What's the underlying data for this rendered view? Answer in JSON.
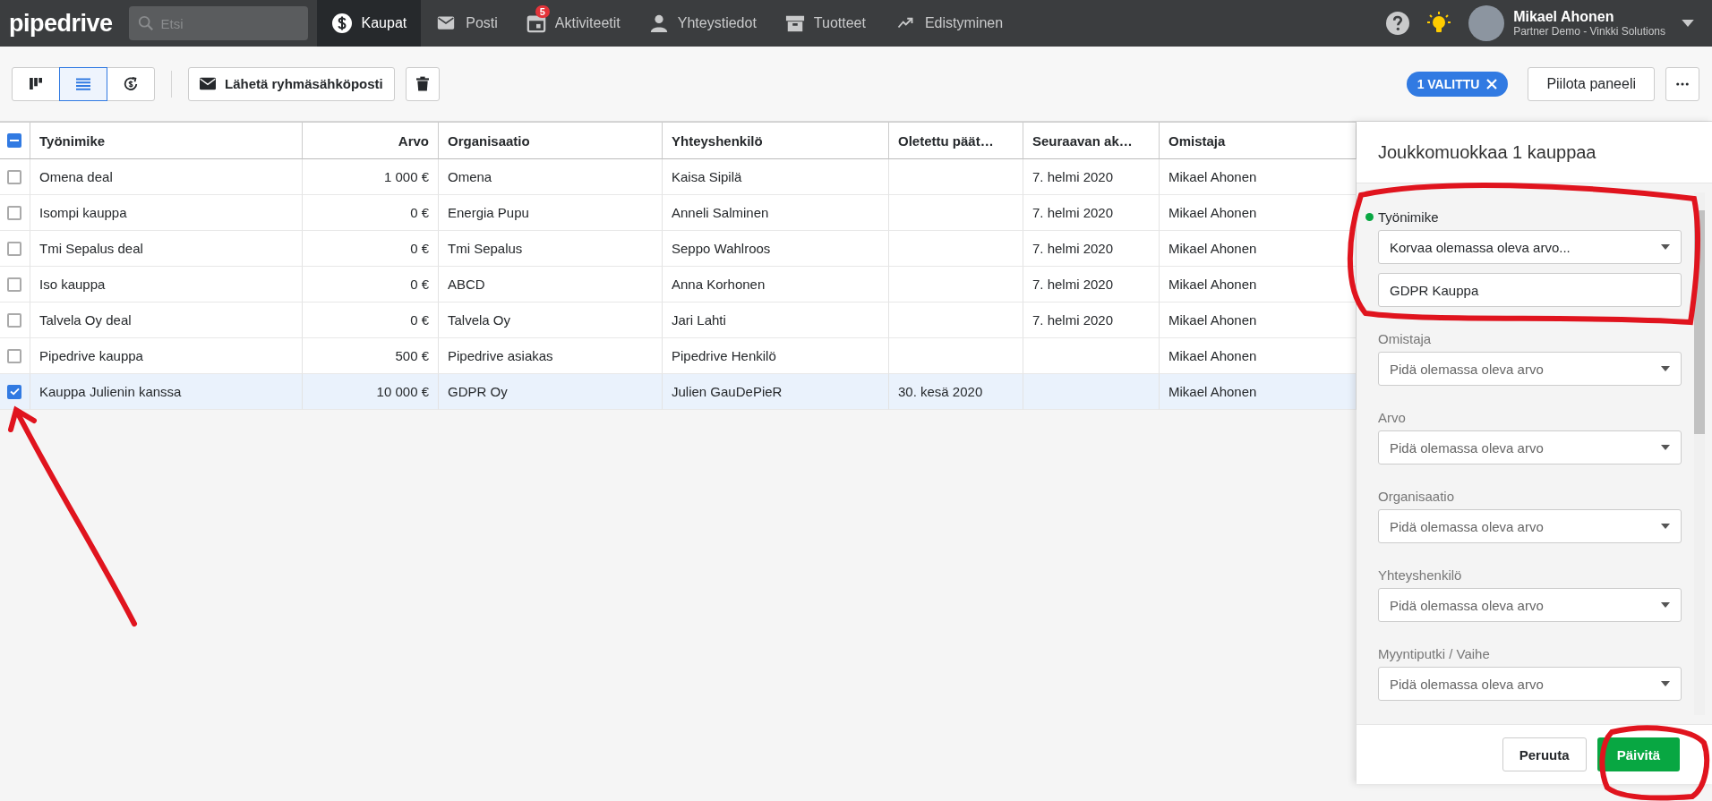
{
  "nav": {
    "logo": "pipedrive",
    "search": {
      "placeholder": "Etsi"
    },
    "items": [
      {
        "label": "Kaupat",
        "selected": true
      },
      {
        "label": "Posti",
        "selected": false
      },
      {
        "label": "Aktiviteetit",
        "selected": false,
        "badge": "5"
      },
      {
        "label": "Yhteystiedot",
        "selected": false
      },
      {
        "label": "Tuotteet",
        "selected": false
      },
      {
        "label": "Edistyminen",
        "selected": false
      }
    ],
    "user": {
      "name": "Mikael Ahonen",
      "company": "Partner Demo - Vinkki Solutions"
    }
  },
  "toolbar": {
    "views": [
      {
        "selected": false
      },
      {
        "selected": true
      },
      {
        "selected": false
      }
    ],
    "email_button": "Lähetä ryhmäsähköposti",
    "selection_badge": "1 VALITTU",
    "hide_panel_button": "Piilota paneeli"
  },
  "table": {
    "all_partial": true,
    "columns": [
      "Työnimike",
      "Arvo",
      "Organisaatio",
      "Yhteyshenkilö",
      "Oletettu päät…",
      "Seuraavan ak…",
      "Omistaja"
    ],
    "rows": [
      {
        "selected": false,
        "cells": [
          "Omena deal",
          "1 000 €",
          "Omena",
          "Kaisa Sipilä",
          "",
          "7. helmi 2020",
          "Mikael Ahonen"
        ]
      },
      {
        "selected": false,
        "cells": [
          "Isompi kauppa",
          "0 €",
          "Energia Pupu",
          "Anneli Salminen",
          "",
          "7. helmi 2020",
          "Mikael Ahonen"
        ]
      },
      {
        "selected": false,
        "cells": [
          "Tmi Sepalus deal",
          "0 €",
          "Tmi Sepalus",
          "Seppo Wahlroos",
          "",
          "7. helmi 2020",
          "Mikael Ahonen"
        ]
      },
      {
        "selected": false,
        "cells": [
          "Iso kauppa",
          "0 €",
          "ABCD",
          "Anna Korhonen",
          "",
          "7. helmi 2020",
          "Mikael Ahonen"
        ]
      },
      {
        "selected": false,
        "cells": [
          "Talvela Oy deal",
          "0 €",
          "Talvela Oy",
          "Jari Lahti",
          "",
          "7. helmi 2020",
          "Mikael Ahonen"
        ]
      },
      {
        "selected": false,
        "cells": [
          "Pipedrive kauppa",
          "500 €",
          "Pipedrive asiakas",
          "Pipedrive Henkilö",
          "",
          "",
          "Mikael Ahonen"
        ]
      },
      {
        "selected": true,
        "cells": [
          "Kauppa Julienin kanssa",
          "10 000 €",
          "GDPR Oy",
          "Julien GauDePieR",
          "30. kesä 2020",
          "",
          "Mikael Ahonen"
        ]
      }
    ]
  },
  "panel": {
    "title": "Joukkomuokkaa 1 kauppaa",
    "fields": [
      {
        "label": "Työnimike",
        "changed": true,
        "mode": "Korvaa olemassa oleva arvo...",
        "value": "GDPR Kauppa"
      },
      {
        "label": "Omistaja",
        "changed": false,
        "mode": "Pidä olemassa oleva arvo"
      },
      {
        "label": "Arvo",
        "changed": false,
        "mode": "Pidä olemassa oleva arvo"
      },
      {
        "label": "Organisaatio",
        "changed": false,
        "mode": "Pidä olemassa oleva arvo"
      },
      {
        "label": "Yhteyshenkilö",
        "changed": false,
        "mode": "Pidä olemassa oleva arvo"
      },
      {
        "label": "Myyntiputki / Vaihe",
        "changed": false,
        "mode": "Pidä olemassa oleva arvo"
      }
    ],
    "cancel_button": "Peruuta",
    "update_button": "Päivitä"
  }
}
